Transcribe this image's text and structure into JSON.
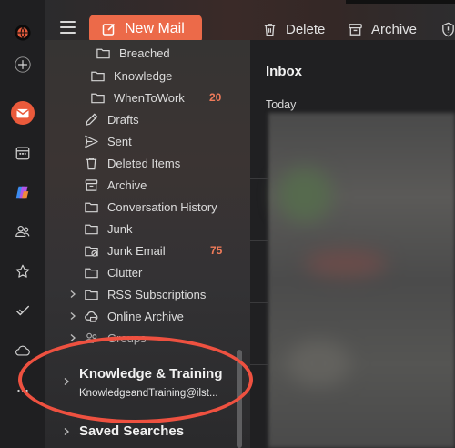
{
  "toolbar": {
    "new_mail_label": "New Mail",
    "delete_label": "Delete",
    "archive_label": "Archive"
  },
  "folders": {
    "breached": "Breached",
    "knowledge": "Knowledge",
    "whentowork": "WhenToWork",
    "whentowork_count": "20",
    "drafts": "Drafts",
    "sent": "Sent",
    "deleted": "Deleted Items",
    "archive": "Archive",
    "conversation": "Conversation History",
    "junk": "Junk",
    "junk_email": "Junk Email",
    "junk_email_count": "75",
    "clutter": "Clutter",
    "rss": "RSS Subscriptions",
    "online_archive": "Online Archive",
    "groups": "Groups"
  },
  "account": {
    "title": "Knowledge & Training",
    "email": "KnowledgeandTraining@ilst..."
  },
  "saved_searches": "Saved Searches",
  "message_list": {
    "title": "Inbox",
    "section": "Today"
  },
  "colors": {
    "accent": "#ec6a49",
    "highlight": "#ee5140",
    "badge": "#f07b5a"
  },
  "rail_icons": [
    "globe-icon",
    "plus-icon",
    "mail-icon",
    "calendar-icon",
    "copilot-icon",
    "people-icon",
    "star-icon",
    "todo-icon",
    "cloud-icon"
  ]
}
